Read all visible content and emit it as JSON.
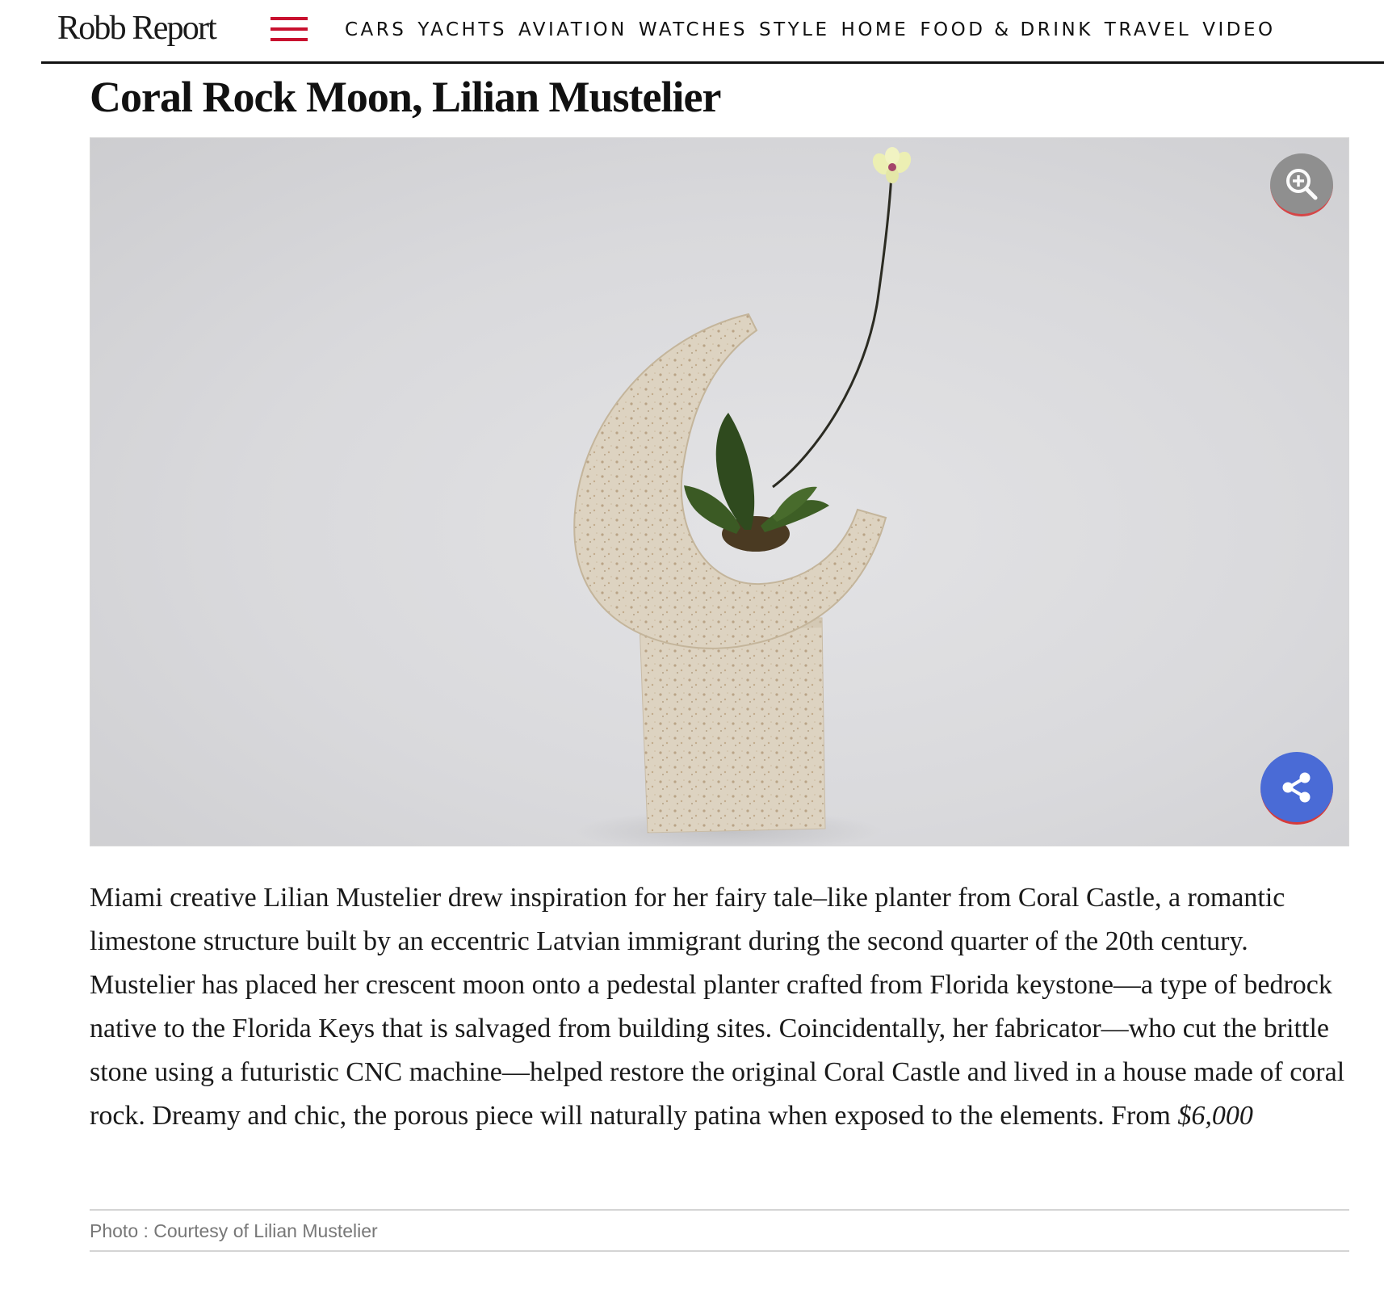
{
  "header": {
    "logo": "Robb Report",
    "menu_icon": "hamburger-menu-icon",
    "accent_color": "#c8102e",
    "nav_items": [
      "CARS",
      "YACHTS",
      "AVIATION",
      "WATCHES",
      "STYLE",
      "HOME",
      "FOOD & DRINK",
      "TRAVEL",
      "VIDEO"
    ]
  },
  "article": {
    "title": "Coral Rock Moon, Lilian Mustelier",
    "body": "Miami creative Lilian Mustelier drew inspiration for her fairy tale–like planter from Coral Castle, a romantic limestone structure built by an eccentric Latvian immigrant during the second quarter of the 20th century. Mustelier has placed her crescent moon onto a pedestal planter crafted from Florida keystone—a type of bedrock native to the Florida Keys that is salvaged from building sites. Coincidentally, her fabricator—who cut the brittle stone using a futuristic CNC machine—helped restore the original Coral Castle and lived in a house made of coral rock. Dreamy and chic, the porous piece will naturally patina when exposed to the elements. From ",
    "price": "$6,000",
    "photo_credit": "Photo : Courtesy of Lilian Mustelier"
  },
  "figure": {
    "zoom_icon": "zoom-in-icon",
    "share_icon": "share-icon",
    "share_color": "#4a6bd6"
  }
}
